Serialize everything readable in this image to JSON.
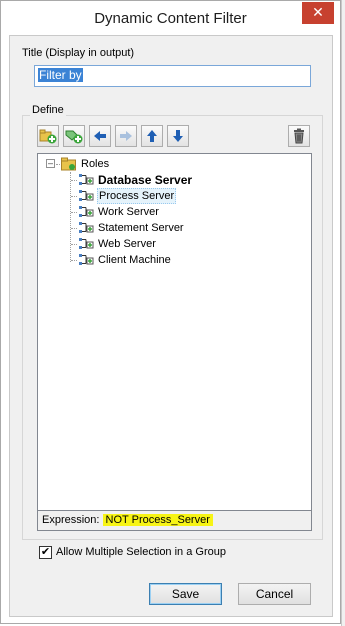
{
  "window": {
    "title": "Dynamic Content Filter",
    "close_glyph": "✕"
  },
  "title_field": {
    "label": "Title (Display in output)",
    "value": "Filter by"
  },
  "define": {
    "label": "Define",
    "toolbar": [
      {
        "name": "add-role-icon",
        "enabled": true
      },
      {
        "name": "add-item-icon",
        "enabled": true
      },
      {
        "name": "arrow-left-icon",
        "enabled": true
      },
      {
        "name": "arrow-right-icon",
        "enabled": false
      },
      {
        "name": "arrow-up-icon",
        "enabled": true
      },
      {
        "name": "arrow-down-icon",
        "enabled": true
      },
      {
        "name": "delete-icon",
        "enabled": true
      }
    ],
    "tree": {
      "root": {
        "label": "Roles",
        "expanded": true
      },
      "items": [
        {
          "label": "Database Server",
          "bold": true,
          "hover": false
        },
        {
          "label": "Process Server",
          "bold": false,
          "hover": true
        },
        {
          "label": "Work Server",
          "bold": false,
          "hover": false
        },
        {
          "label": "Statement Server",
          "bold": false,
          "hover": false
        },
        {
          "label": "Web Server",
          "bold": false,
          "hover": false
        },
        {
          "label": "Client Machine",
          "bold": false,
          "hover": false
        }
      ]
    },
    "expression": {
      "label": "Expression:",
      "value": "NOT Process_Server",
      "highlight_color": "#f7f415"
    }
  },
  "allow_multiple": {
    "label": "Allow Multiple Selection in a Group",
    "checked": true,
    "check_glyph": "✔"
  },
  "buttons": {
    "save": "Save",
    "cancel": "Cancel"
  },
  "colors": {
    "close_button": "#c7412f",
    "selection": "#3b83d5",
    "accent_blue": "#1f5fb4",
    "folder_yellow": "#e8c34a",
    "add_green": "#3aa53a"
  }
}
